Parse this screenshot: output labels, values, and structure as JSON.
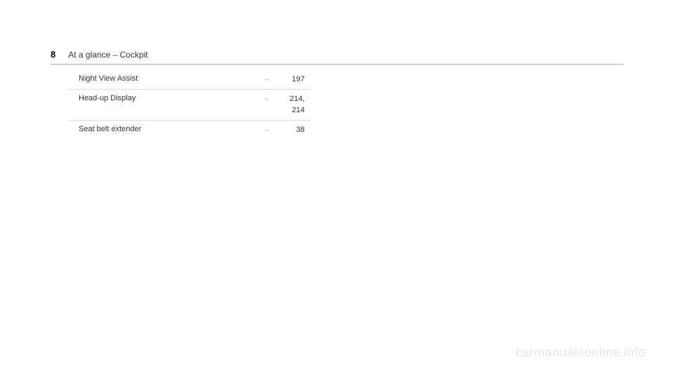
{
  "header": {
    "page_number": "8",
    "section_title": "At a glance – Cockpit"
  },
  "rows": [
    {
      "label": "Night View Assist",
      "arrow": "→",
      "pages": "197"
    },
    {
      "label": "Head-up Display",
      "arrow": "→",
      "pages": "214,\n214"
    },
    {
      "label": "Seat belt extender",
      "arrow": "→",
      "pages": "38"
    }
  ],
  "watermark": "carmanualsonline.info"
}
